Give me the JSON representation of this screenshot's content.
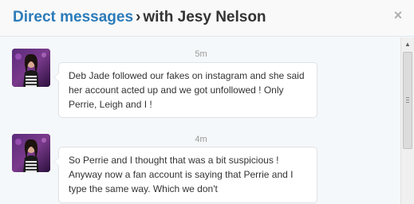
{
  "header": {
    "breadcrumb_link": "Direct messages",
    "separator": "›",
    "conversation": "with Jesy Nelson",
    "close_label": "×"
  },
  "messages": [
    {
      "time": "5m",
      "text": "Deb Jade followed our fakes on instagram and she said her account acted up and we got unfollowed ! Only Perrie, Leigh and I !"
    },
    {
      "time": "4m",
      "text": "So Perrie and I thought that was a bit suspicious ! Anyway now a fan account is saying that Perrie and I type the same way. Which we don't"
    }
  ],
  "scrollbar": {
    "up_arrow": "▲"
  }
}
